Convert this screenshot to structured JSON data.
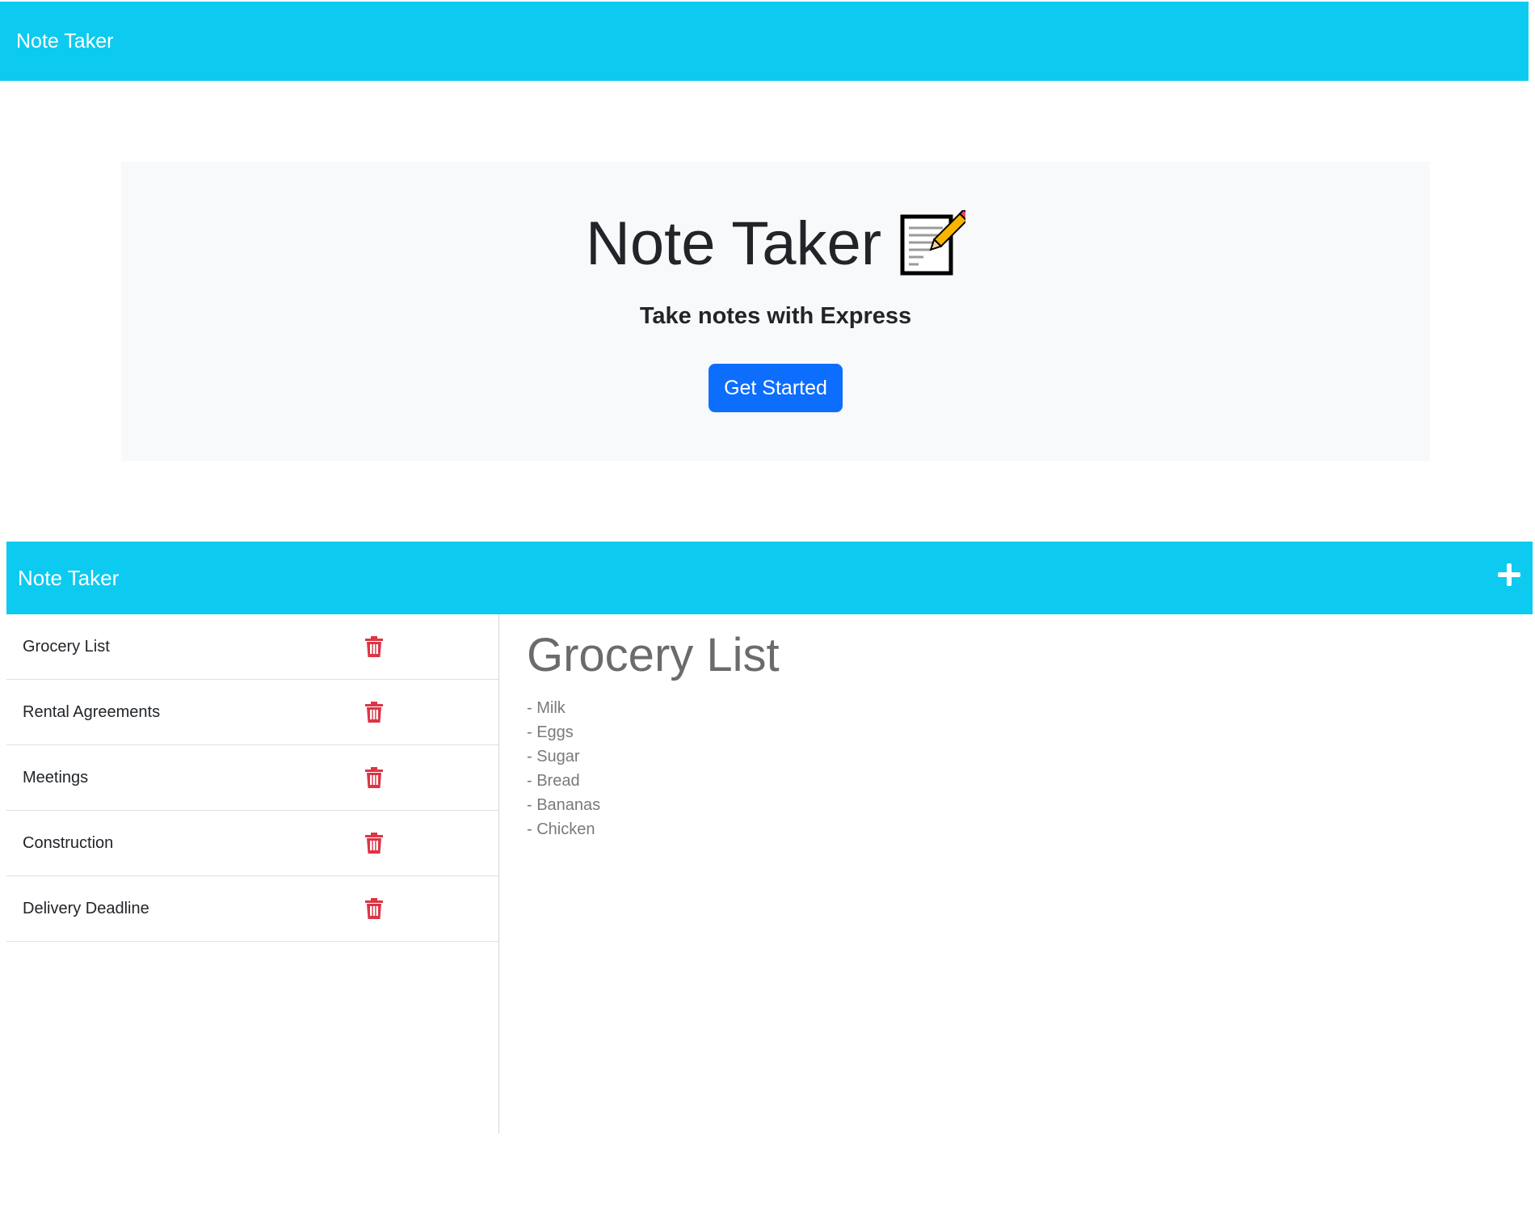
{
  "landing": {
    "brand": "Note Taker",
    "hero": {
      "title": "Note Taker",
      "icon": "memo-icon",
      "subtitle": "Take notes with Express",
      "button_label": "Get Started"
    }
  },
  "app": {
    "brand": "Note Taker",
    "add_icon": "plus-icon",
    "notes": [
      {
        "title": "Grocery List"
      },
      {
        "title": "Rental Agreements"
      },
      {
        "title": "Meetings"
      },
      {
        "title": "Construction"
      },
      {
        "title": "Delivery Deadline"
      }
    ],
    "active_note": {
      "title": "Grocery List",
      "lines": [
        "- Milk",
        "- Eggs",
        "- Sugar",
        "- Bread",
        "- Bananas",
        "- Chicken"
      ]
    }
  },
  "colors": {
    "navbar": "#0dcaf0",
    "primary_button": "#0d6efd",
    "hero_bg": "#f8f9fa",
    "delete_icon": "#dc3545"
  }
}
